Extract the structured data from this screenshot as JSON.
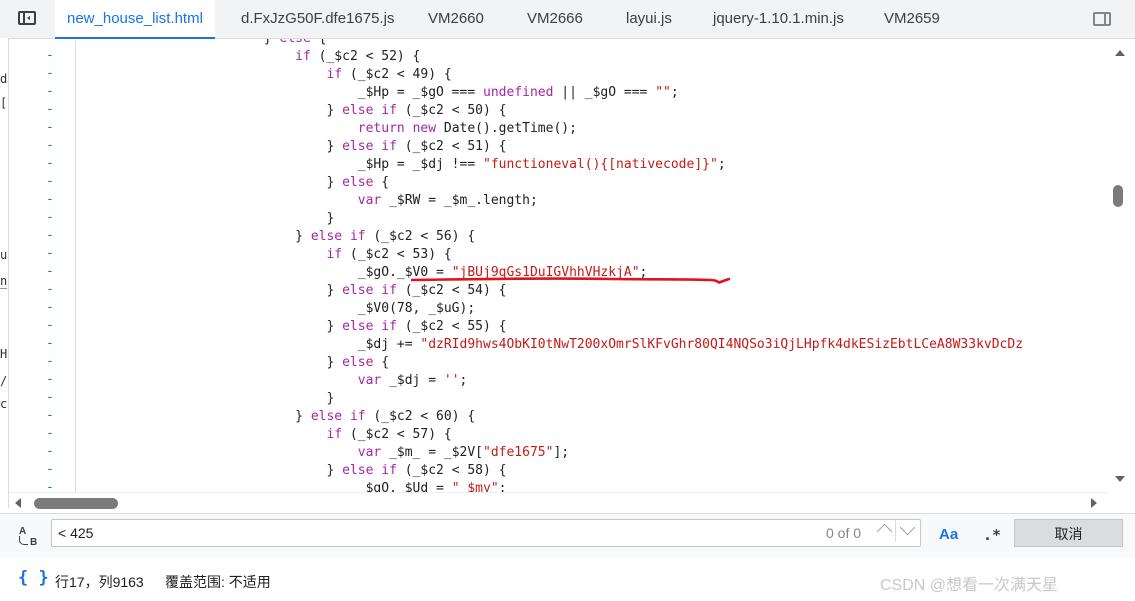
{
  "tabs": [
    {
      "label": "new_house_list.html",
      "active": true
    },
    {
      "label": "d.FxJzG50F.dfe1675.js"
    },
    {
      "label": "VM2660"
    },
    {
      "label": "VM2666"
    },
    {
      "label": "layui.js"
    },
    {
      "label": "jquery-1.10.1.min.js"
    },
    {
      "label": "VM2659"
    }
  ],
  "left_strip": [
    "d",
    "[",
    "u",
    "n",
    "H",
    "/",
    "c"
  ],
  "code_lines": [
    "                        } else {",
    "                            if (_$c2 < 52) {",
    "                                if (_$c2 < 49) {",
    "                                    _$Hp = _$gO === undefined || _$gO === \"\";",
    "                                } else if (_$c2 < 50) {",
    "                                    return new Date().getTime();",
    "                                } else if (_$c2 < 51) {",
    "                                    _$Hp = _$dj !== \"functioneval(){[nativecode]}\";",
    "                                } else {",
    "                                    var _$RW = _$m_.length;",
    "                                }",
    "                            } else if (_$c2 < 56) {",
    "                                if (_$c2 < 53) {",
    "                                    _$gO._$V0 = \"jBUj9qGs1DuIGVhhVHzkjA\";",
    "                                } else if (_$c2 < 54) {",
    "                                    _$V0(78, _$uG);",
    "                                } else if (_$c2 < 55) {",
    "                                    _$dj += \"dzRId9hws4ObKI0tNwT200xOmrSlKFvGhr80QI4NQSo3iQjLHpfk4dkESizEbtLCeA8W33kvDcDz",
    "                                } else {",
    "                                    var _$dj = '';",
    "                                }",
    "                            } else if (_$c2 < 60) {",
    "                                if (_$c2 < 57) {",
    "                                    var _$m_ = _$2V[\"dfe1675\"];",
    "                                } else if (_$c2 < 58) {",
    "                                    _$gO._$Ud = \"_$my\";"
  ],
  "gutter_mark": "-",
  "search": {
    "value": "< 425",
    "match_count": "0 of 0",
    "case_label": "Aa",
    "regex_label": ".*",
    "cancel_label": "取消"
  },
  "status": {
    "braces": "{ }",
    "cursor": "行17，列9163",
    "coverage": "覆盖范围: 不适用"
  },
  "watermark": "CSDN @想看一次满天星",
  "colors": {
    "accent": "#1a73e8",
    "keyword": "#a626a4",
    "string": "#c41a16",
    "annotation": "#e0141e"
  }
}
